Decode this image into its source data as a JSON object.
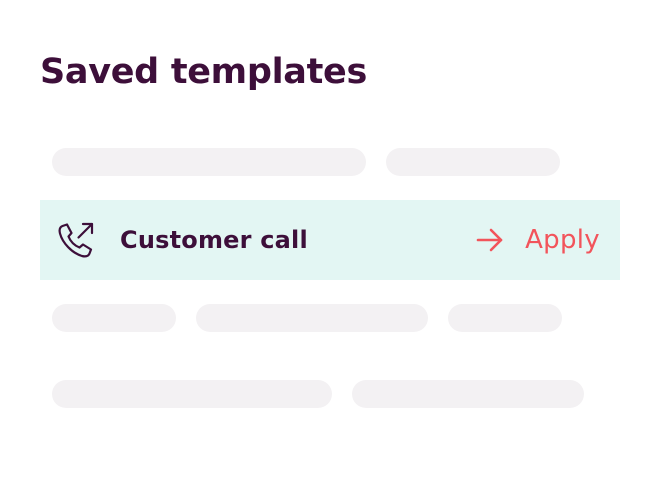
{
  "page": {
    "title": "Saved templates"
  },
  "selected_template": {
    "icon": "phone-outgoing-icon",
    "label": "Customer call",
    "action_icon": "arrow-right-icon",
    "action_label": "Apply"
  },
  "colors": {
    "title": "#3d0f3a",
    "selected_row_bg": "#e3f6f3",
    "accent": "#f2545b",
    "skeleton": "#f3f1f3"
  }
}
